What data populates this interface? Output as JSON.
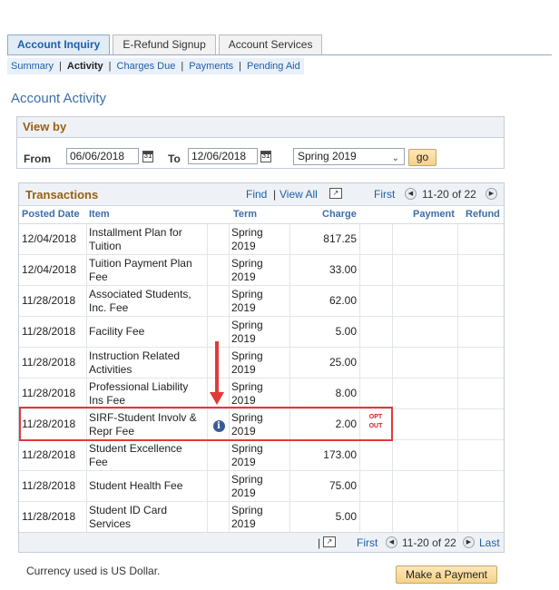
{
  "tabs": [
    {
      "label": "Account Inquiry",
      "active": true
    },
    {
      "label": "E-Refund Signup",
      "active": false
    },
    {
      "label": "Account Services",
      "active": false
    }
  ],
  "subnav": {
    "summary": "Summary",
    "activity": "Activity",
    "charges_due": "Charges Due",
    "payments": "Payments",
    "pending_aid": "Pending Aid",
    "separator": "|"
  },
  "page_title": "Account Activity",
  "view_by": {
    "header": "View by",
    "from_label": "From",
    "from_value": "06/06/2018",
    "to_label": "To",
    "to_value": "12/06/2018",
    "term_value": "Spring 2019",
    "go_label": "go",
    "calendar_icon_text": "31"
  },
  "transactions": {
    "title": "Transactions",
    "find": "Find",
    "separator": "|",
    "view_all": "View All",
    "first": "First",
    "range": "11-20 of 22",
    "last": "Last",
    "columns": {
      "posted_date": "Posted Date",
      "item": "Item",
      "term": "Term",
      "charge": "Charge",
      "payment": "Payment",
      "refund": "Refund"
    },
    "rows": [
      {
        "date": "12/04/2018",
        "item_l1": "Installment Plan for",
        "item_l2": "Tuition",
        "term_l1": "Spring",
        "term_l2": "2019",
        "charge": "817.25"
      },
      {
        "date": "12/04/2018",
        "item_l1": "Tuition Payment Plan",
        "item_l2": "Fee",
        "term_l1": "Spring",
        "term_l2": "2019",
        "charge": "33.00"
      },
      {
        "date": "11/28/2018",
        "item_l1": "Associated Students,",
        "item_l2": "Inc. Fee",
        "term_l1": "Spring",
        "term_l2": "2019",
        "charge": "62.00"
      },
      {
        "date": "11/28/2018",
        "item_l1": "Facility Fee",
        "item_l2": "",
        "term_l1": "Spring",
        "term_l2": "2019",
        "charge": "5.00"
      },
      {
        "date": "11/28/2018",
        "item_l1": "Instruction Related",
        "item_l2": "Activities",
        "term_l1": "Spring",
        "term_l2": "2019",
        "charge": "25.00"
      },
      {
        "date": "11/28/2018",
        "item_l1": "Professional Liability",
        "item_l2": "Ins Fee",
        "term_l1": "Spring",
        "term_l2": "2019",
        "charge": "8.00"
      },
      {
        "date": "11/28/2018",
        "item_l1": "SIRF-Student Involv &",
        "item_l2": "Repr Fee",
        "term_l1": "Spring",
        "term_l2": "2019",
        "charge": "2.00",
        "opt_out_l1": "OPT",
        "opt_out_l2": "OUT"
      },
      {
        "date": "11/28/2018",
        "item_l1": "Student Excellence",
        "item_l2": "Fee",
        "term_l1": "Spring",
        "term_l2": "2019",
        "charge": "173.00"
      },
      {
        "date": "11/28/2018",
        "item_l1": "Student Health Fee",
        "item_l2": "",
        "term_l1": "Spring",
        "term_l2": "2019",
        "charge": "75.00"
      },
      {
        "date": "11/28/2018",
        "item_l1": "Student ID Card",
        "item_l2": "Services",
        "term_l1": "Spring",
        "term_l2": "2019",
        "charge": "5.00"
      }
    ]
  },
  "currency_note": "Currency used is US Dollar.",
  "make_payment_label": "Make a Payment",
  "colors": {
    "accent": "#1f5ea8",
    "header_orange": "#9b5f11",
    "highlight_red": "#e03a3a"
  }
}
